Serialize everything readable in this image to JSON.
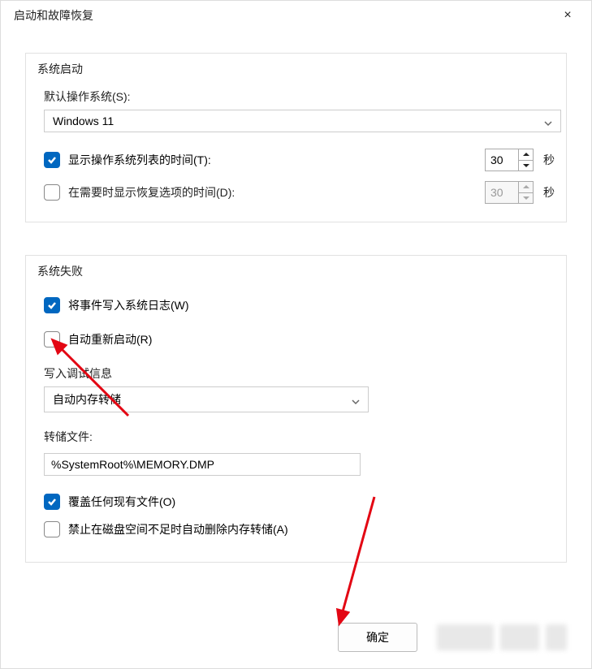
{
  "titlebar": {
    "title": "启动和故障恢复",
    "close_icon": "×"
  },
  "startup": {
    "section_title": "系统启动",
    "default_os_label": "默认操作系统(S):",
    "default_os_value": "Windows 11",
    "show_os_list": {
      "label": "显示操作系统列表的时间(T):",
      "checked": true,
      "seconds": "30",
      "unit": "秒"
    },
    "show_recovery": {
      "label": "在需要时显示恢复选项的时间(D):",
      "checked": false,
      "seconds": "30",
      "unit": "秒"
    }
  },
  "failure": {
    "section_title": "系统失败",
    "write_event_log": {
      "label": "将事件写入系统日志(W)",
      "checked": true
    },
    "auto_restart": {
      "label": "自动重新启动(R)",
      "checked": false
    },
    "debug_info_label": "写入调试信息",
    "debug_select_value": "自动内存转储",
    "dump_file_label": "转储文件:",
    "dump_file_value": "%SystemRoot%\\MEMORY.DMP",
    "overwrite": {
      "label": "覆盖任何现有文件(O)",
      "checked": true
    },
    "prohibit_delete": {
      "label": "禁止在磁盘空间不足时自动删除内存转储(A)",
      "checked": false
    }
  },
  "footer": {
    "ok_label": "确定"
  }
}
